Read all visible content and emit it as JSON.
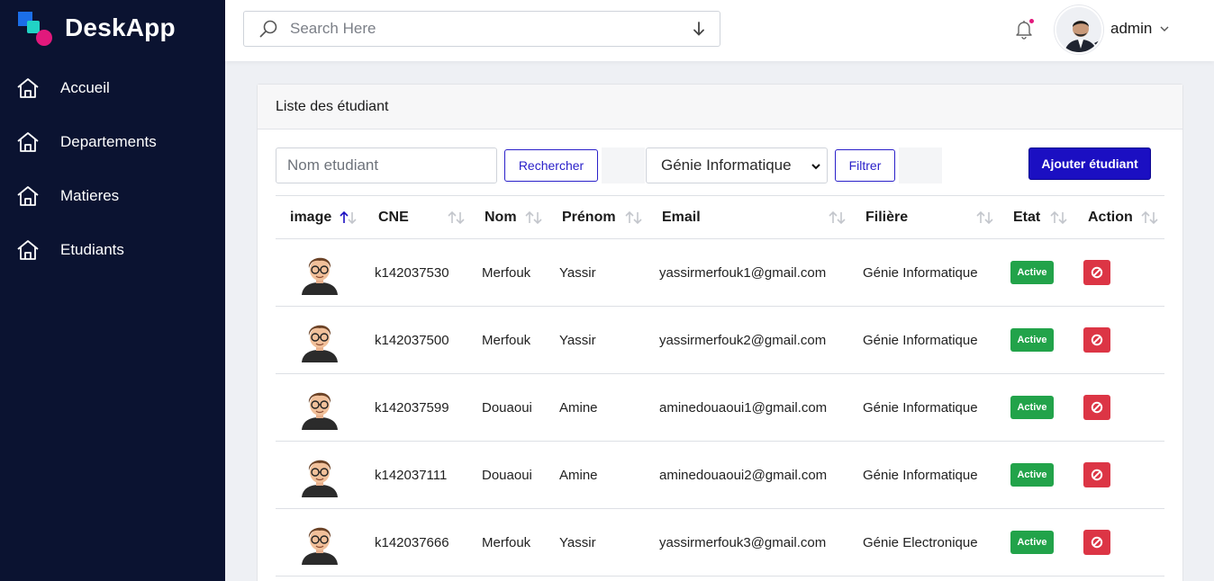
{
  "brand": {
    "name": "DeskApp"
  },
  "sidebar": {
    "items": [
      {
        "label": "Accueil",
        "icon": "home-icon"
      },
      {
        "label": "Departements",
        "icon": "home-icon"
      },
      {
        "label": "Matieres",
        "icon": "home-icon"
      },
      {
        "label": "Etudiants",
        "icon": "home-icon"
      }
    ]
  },
  "header": {
    "search_placeholder": "Search Here",
    "user_name": "admin"
  },
  "card": {
    "title": "Liste des étudiant",
    "name_placeholder": "Nom etudiant",
    "search_button": "Rechercher",
    "filiere_selected": "Génie Informatique",
    "filter_button": "Filtrer",
    "add_button": "Ajouter étudiant"
  },
  "table": {
    "columns": [
      "image",
      "CNE",
      "Nom",
      "Prénom",
      "Email",
      "Filière",
      "Etat",
      "Action"
    ],
    "rows": [
      {
        "cne": "k142037530",
        "nom": "Merfouk",
        "prenom": "Yassir",
        "email": "yassirmerfouk1@gmail.com",
        "filiere": "Génie Informatique",
        "etat": "Active"
      },
      {
        "cne": "k142037500",
        "nom": "Merfouk",
        "prenom": "Yassir",
        "email": "yassirmerfouk2@gmail.com",
        "filiere": "Génie Informatique",
        "etat": "Active"
      },
      {
        "cne": "k142037599",
        "nom": "Douaoui",
        "prenom": "Amine",
        "email": "aminedouaoui1@gmail.com",
        "filiere": "Génie Informatique",
        "etat": "Active"
      },
      {
        "cne": "k142037111",
        "nom": "Douaoui",
        "prenom": "Amine",
        "email": "aminedouaoui2@gmail.com",
        "filiere": "Génie Informatique",
        "etat": "Active"
      },
      {
        "cne": "k142037666",
        "nom": "Merfouk",
        "prenom": "Yassir",
        "email": "yassirmerfouk3@gmail.com",
        "filiere": "Génie Electronique",
        "etat": "Active"
      }
    ]
  },
  "colors": {
    "sidebar_bg": "#0b1331",
    "primary": "#1b0fc2",
    "success": "#22a34a",
    "danger": "#dc3545",
    "accent_pink": "#e2197c"
  }
}
